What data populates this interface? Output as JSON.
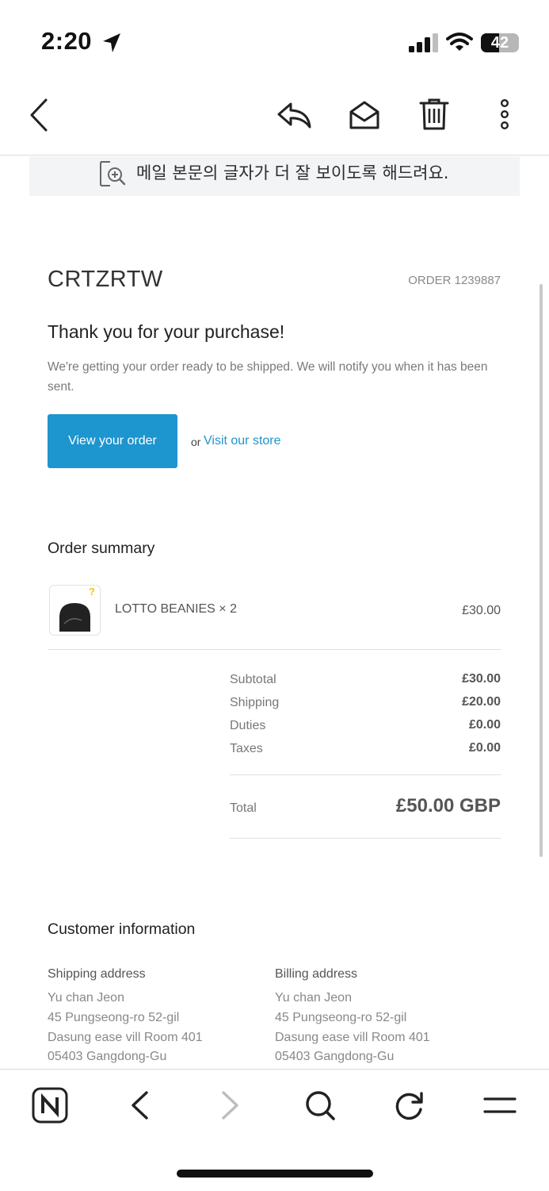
{
  "status_bar": {
    "time": "2:20",
    "battery": "42"
  },
  "toolbar": {
    "back": "back-icon",
    "reply": "reply-icon",
    "mark_unread": "envelope-open-icon",
    "delete": "trash-icon",
    "more": "more-vertical-icon"
  },
  "notice": {
    "text": "메일 본문의 글자가 더 잘 보이도록 해드려요."
  },
  "email": {
    "brand": "CRTZRTW",
    "order_number": "ORDER 1239887",
    "heading": "Thank you for your purchase!",
    "subtext": "We're getting your order ready to be shipped. We will notify you when it has been sent.",
    "view_order_label": "View your order",
    "or_text": "or",
    "visit_store_label": "Visit our store",
    "summary_title": "Order summary",
    "item": {
      "name": "LOTTO BEANIES × 2",
      "price": "£30.00"
    },
    "totals": [
      {
        "label": "Subtotal",
        "value": "£30.00"
      },
      {
        "label": "Shipping",
        "value": "£20.00"
      },
      {
        "label": "Duties",
        "value": "£0.00"
      },
      {
        "label": "Taxes",
        "value": "£0.00"
      }
    ],
    "total_label": "Total",
    "total_value": "£50.00 GBP",
    "customer_title": "Customer information",
    "shipping_address": {
      "heading": "Shipping address",
      "lines": [
        "Yu chan Jeon",
        "45 Pungseong-ro 52-gil",
        "Dasung ease vill Room 401",
        "05403 Gangdong-Gu"
      ]
    },
    "billing_address": {
      "heading": "Billing address",
      "lines": [
        "Yu chan Jeon",
        "45 Pungseong-ro 52-gil",
        "Dasung ease vill Room 401",
        "05403 Gangdong-Gu"
      ]
    }
  },
  "bottom_bar": {
    "items": [
      "naver-n-icon",
      "back-arrow-icon",
      "forward-arrow-icon",
      "search-icon",
      "refresh-icon",
      "menu-icon"
    ]
  },
  "colors": {
    "accent": "#1d95cf",
    "text": "#333333",
    "muted": "#7a7a7a"
  }
}
